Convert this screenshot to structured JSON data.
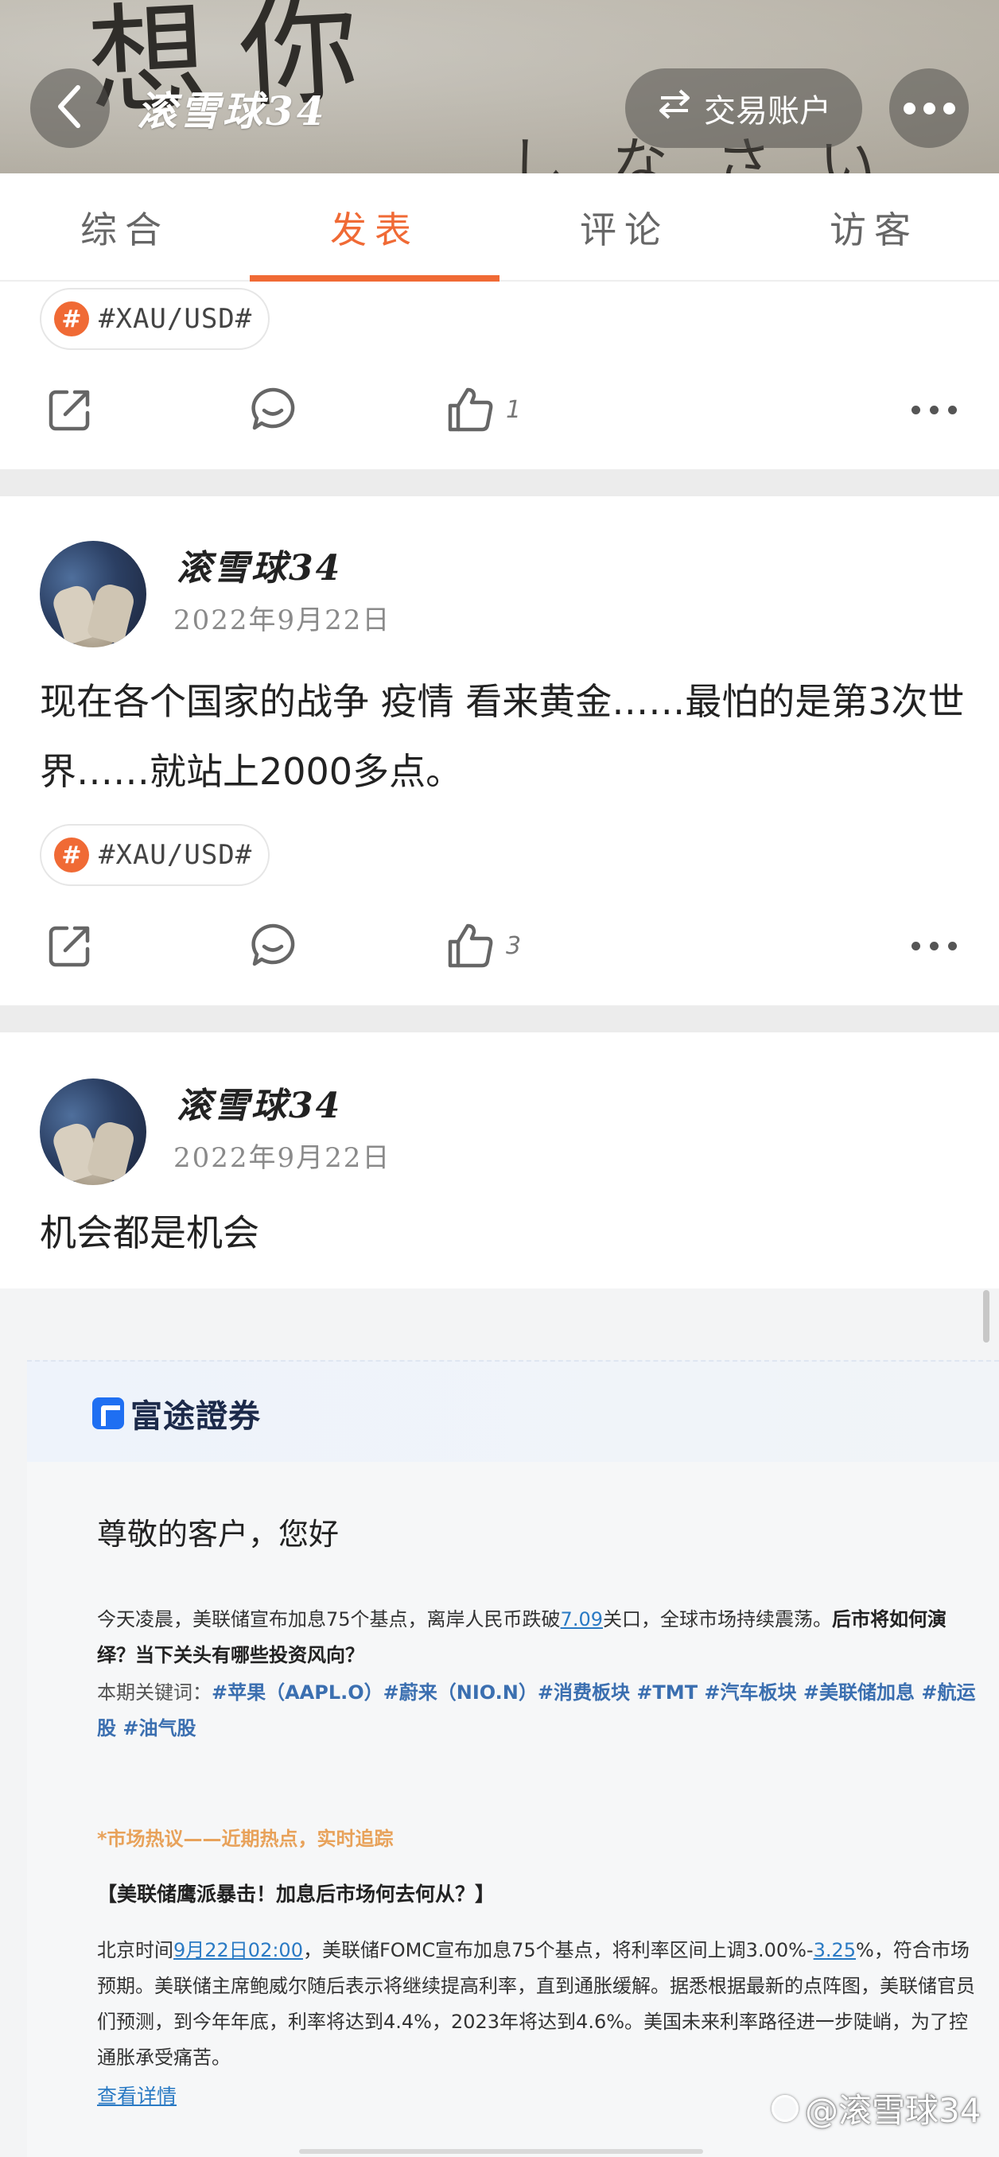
{
  "header": {
    "title": "滚雪球34",
    "account_button": "交易账户",
    "bg_scribble": "想你",
    "bg_scribble2": "しなさい"
  },
  "tabs": [
    {
      "label": "综合",
      "active": false
    },
    {
      "label": "发表",
      "active": true
    },
    {
      "label": "评论",
      "active": false
    },
    {
      "label": "访客",
      "active": false
    }
  ],
  "colors": {
    "accent": "#f06a35",
    "link": "#2a7ac4",
    "keyword": "#3b6fb0"
  },
  "posts": [
    {
      "tag": "#XAU/USD#",
      "like_count": "1"
    },
    {
      "author": "滚雪球34",
      "date": "2022年9月22日",
      "text": "现在各个国家的战争 疫情 看来黄金……最怕的是第3次世界……就站上2000多点。",
      "tag": "#XAU/USD#",
      "like_count": "3"
    },
    {
      "author": "滚雪球34",
      "date": "2022年9月22日",
      "text": "机会都是机会"
    }
  ],
  "embed": {
    "brand": "富途證券",
    "greeting": "尊敬的客户，您好",
    "para1_a": "今天凌晨，美联储宣布加息75个基点，离岸人民币跌破",
    "para1_link": "7.09",
    "para1_b": "关口，全球市场持续震荡。",
    "para1_bold": "后市将如何演绎？当下关头有哪些投资风向？",
    "keywords_label": "本期关键词：",
    "keywords": "#苹果（AAPL.O）#蔚来（NIO.N）#消费板块 #TMT #汽车板块 #美联储加息 #航运股 #油气股",
    "hot": "*市场热议——近期热点，实时追踪",
    "headline": "【美联储鹰派暴击！加息后市场何去何从？】",
    "para2_a": "北京时间",
    "para2_link1": "9月22日02:00",
    "para2_b": "，美联储FOMC宣布加息75个基点，将利率区间上调3.00%-",
    "para2_link2": "3.25",
    "para2_c": "%，符合市场预期。美联储主席鲍威尔随后表示将继续提高利率，直到通胀缓解。据悉根据最新的点阵图，美联储官员们预测，到今年年底，利率将达到4.4%，2023年将达到4.6%。美国未来利率路径进一步陡峭，为了控通胀承受痛苦。",
    "detail_link": "查看详情"
  },
  "watermark": "@滚雪球34"
}
